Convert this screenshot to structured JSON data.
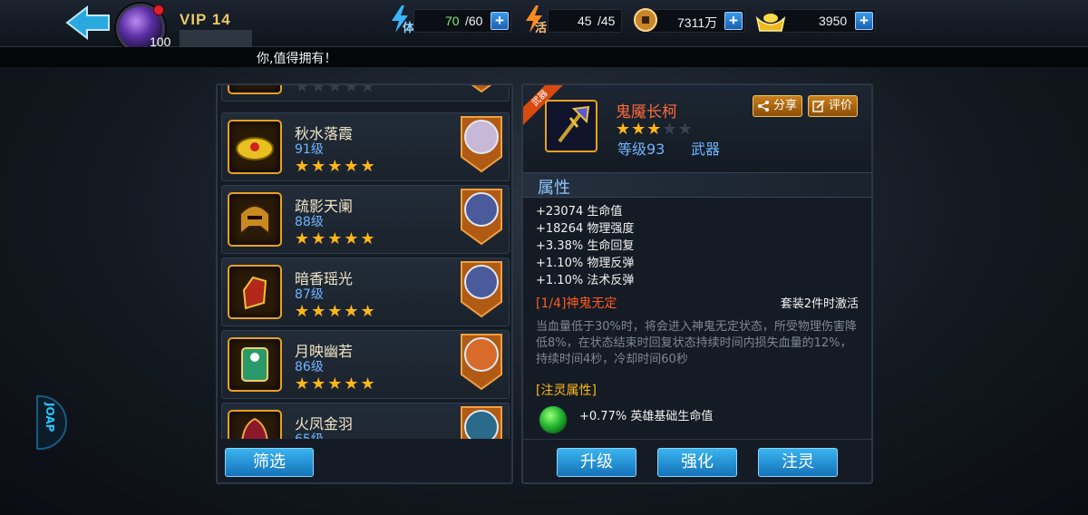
{
  "top": {
    "vip": "VIP 14",
    "player_level": "100",
    "stamina": {
      "tag": "体",
      "current": "70",
      "max": "/60"
    },
    "vitality": {
      "tag": "活",
      "current": "45",
      "max": "/45"
    },
    "coins": "7311万",
    "gold": "3950",
    "plus": "+"
  },
  "marquee": "你,值得拥有！",
  "side_badge": "JOAP",
  "list": {
    "items": [
      {
        "name": "",
        "level": "",
        "stars": "★★★★★"
      },
      {
        "name": "秋水落霞",
        "level": "91级",
        "stars": "★★★★★"
      },
      {
        "name": "疏影天阑",
        "level": "88级",
        "stars": "★★★★★"
      },
      {
        "name": "暗香瑶光",
        "level": "87级",
        "stars": "★★★★★"
      },
      {
        "name": "月映幽若",
        "level": "86级",
        "stars": "★★★★★"
      },
      {
        "name": "火凤金羽",
        "level": "65级",
        "stars": "★★★★★"
      }
    ],
    "filter_label": "筛选"
  },
  "detail": {
    "ribbon": "武器",
    "name": "鬼魇长柯",
    "stars_on": "★★★",
    "stars_off": "★★",
    "level": "等级93",
    "type": "武器",
    "share_label": "分享",
    "review_label": "评价",
    "attr_title": "属性",
    "stats": [
      "+23074 生命值",
      "+18264 物理强度",
      "+3.38% 生命回复",
      "+1.10% 物理反弹",
      "+1.10% 法术反弹"
    ],
    "set_name": "[1/4]神鬼无定",
    "set_condition": "套装2件时激活",
    "set_desc": "当血量低于30%时，将会进入神鬼无定状态，所受物理伤害降低8%，在状态结束时回复状态持续时间内损失血量的12%，持续时间4秒，冷却时间60秒",
    "spirit_title": "[注灵属性]",
    "spirit_value": "+0.77% 英雄基础生命值",
    "buttons": {
      "upgrade": "升级",
      "enhance": "强化",
      "infuse": "注灵"
    }
  }
}
